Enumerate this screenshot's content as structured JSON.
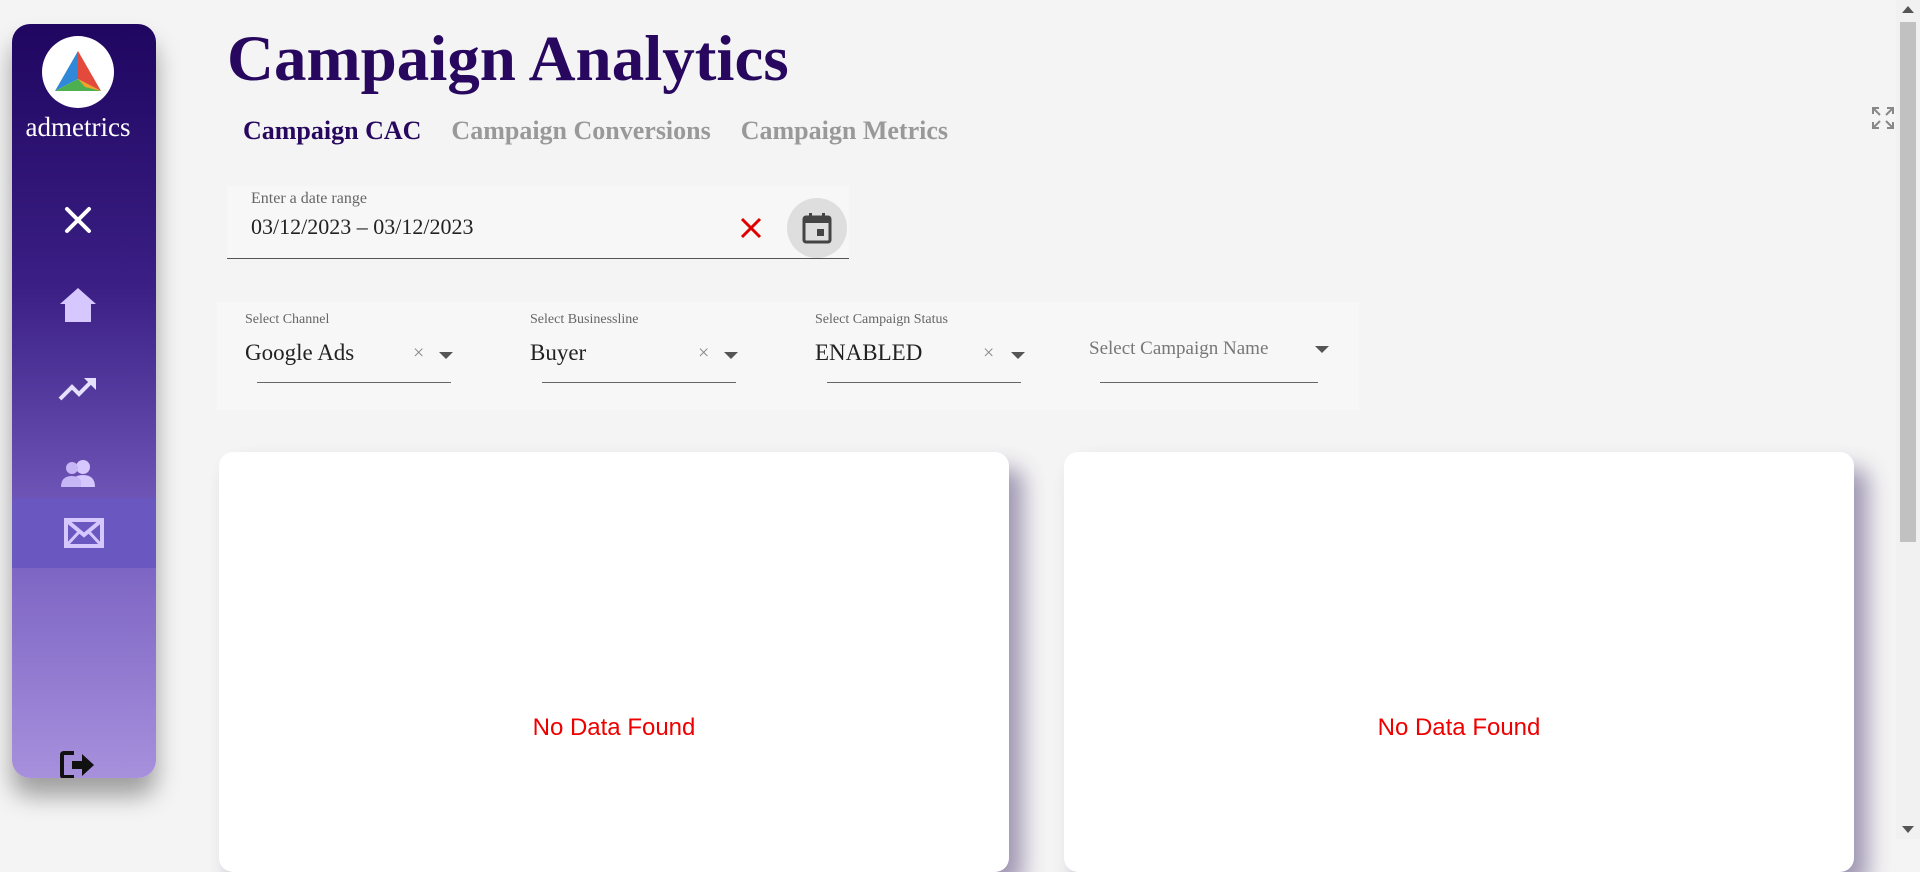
{
  "sidebar": {
    "brand": "admetrics",
    "icons": [
      "close-icon",
      "home-icon",
      "trending-up-icon",
      "users-icon",
      "mail-icon",
      "logout-icon"
    ],
    "active_item": "mail-icon"
  },
  "page": {
    "title": "Campaign Analytics",
    "tabs": [
      {
        "label": "Campaign CAC",
        "active": true
      },
      {
        "label": "Campaign Conversions",
        "active": false
      },
      {
        "label": "Campaign Metrics",
        "active": false
      }
    ]
  },
  "date_range": {
    "label": "Enter a date range",
    "value": "03/12/2023 – 03/12/2023"
  },
  "filters": {
    "channel": {
      "label": "Select Channel",
      "value": "Google Ads"
    },
    "businessline": {
      "label": "Select Businessline",
      "value": "Buyer"
    },
    "status": {
      "label": "Select Campaign Status",
      "value": "ENABLED"
    },
    "campaign_name": {
      "placeholder": "Select Campaign Name"
    }
  },
  "cards": [
    {
      "message": "No Data Found"
    },
    {
      "message": "No Data Found"
    }
  ],
  "colors": {
    "title": "#27085e",
    "error": "#e00000",
    "sidebar_top": "#1f0660",
    "sidebar_bottom": "#a790dc"
  }
}
